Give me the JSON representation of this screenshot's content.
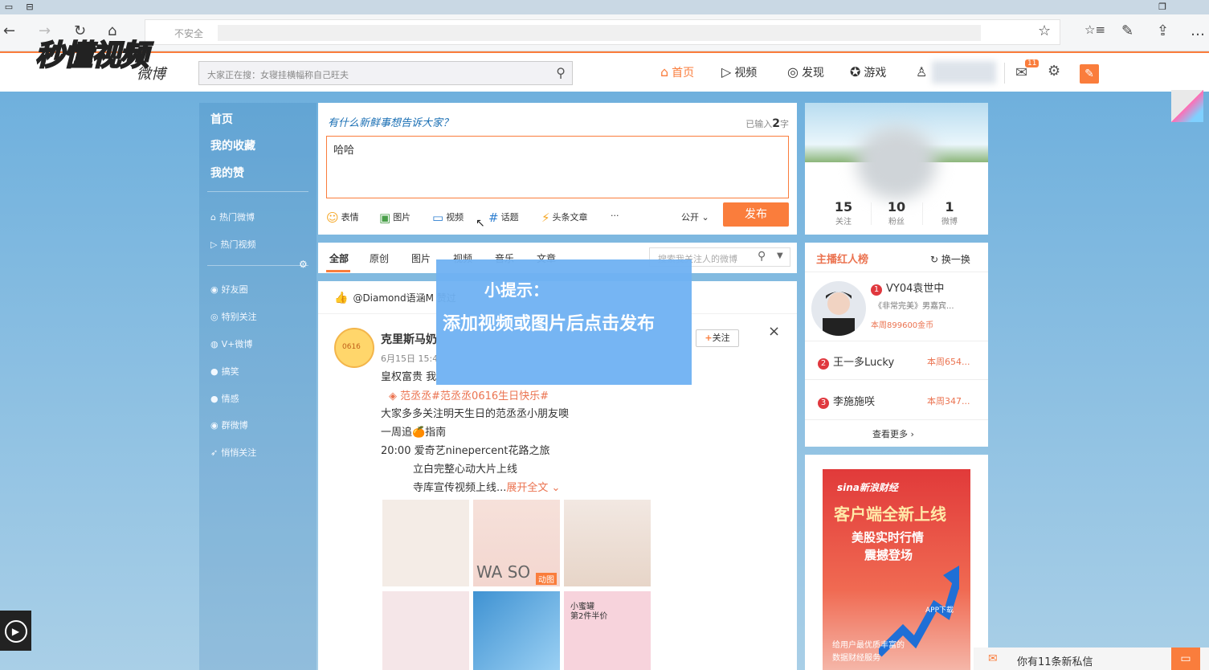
{
  "browser": {
    "url_prefix": "不安全",
    "back": "←",
    "forward": "→",
    "refresh": "↻",
    "home": "⌂",
    "star": "☆",
    "favorites": "☆≡",
    "pen": "✎",
    "share": "⇪",
    "more": "…"
  },
  "watermark": "秒懂视频",
  "logo_word": "微博",
  "header": {
    "search_placeholder": "大家正在搜：女寝挂横幅称自己旺夫",
    "nav": [
      {
        "label": "首页",
        "icon": "⌂"
      },
      {
        "label": "视频",
        "icon": "▷"
      },
      {
        "label": "发现",
        "icon": "◎"
      },
      {
        "label": "游戏",
        "icon": "✪"
      }
    ],
    "user_icon": "♙",
    "msg_icon": "✉",
    "msg_badge": "11",
    "settings_icon": "⚙",
    "compose_icon": "✎",
    "accent": "#fa7d3c"
  },
  "leftnav": {
    "primary": [
      "首页",
      "我的收藏",
      "我的赞"
    ],
    "hot": [
      "热门微博",
      "热门视频"
    ],
    "groups": [
      "好友圈",
      "特别关注",
      "V+微博",
      "搞笑",
      "情感",
      "群微博",
      "悄悄关注"
    ]
  },
  "composer": {
    "title": "有什么新鲜事想告诉大家？",
    "count_prefix": "已输入",
    "count_value": "2",
    "count_suffix": "字",
    "content": "哈哈",
    "tools": [
      "表情",
      "图片",
      "视频",
      "话题",
      "头条文章",
      "···"
    ],
    "visibility": "公开",
    "publish": "发布"
  },
  "feed_tabs": {
    "tabs": [
      "全部",
      "原创",
      "图片",
      "视频",
      "音乐",
      "文章"
    ],
    "search_placeholder": "搜索我关注人的微博"
  },
  "post": {
    "liked_by": "@Diamond语涵M 赞过",
    "avatar_text": "0616",
    "author": "克里斯马奶",
    "time": "6月15日 15:4",
    "line1": "皇权富贵 我",
    "line2_tag1": "范丞丞",
    "line2_tag2": "#范丞丞0616生日快乐#",
    "line3": "大家多多关注明天生日的范丞丞小朋友噢",
    "line4": "一周追🍊指南",
    "line5": "20:00 爱奇艺ninepercent花路之旅",
    "line6": "立白完整心动大片上线",
    "line7": "寺库宣传视频上线...",
    "expand": "展开全文",
    "follow": "关注",
    "follow_plus": "+",
    "close": "×",
    "waso": "WA SO",
    "gif_tag": "动图",
    "promo_line1": "小蜜罐",
    "promo_line2": "第2件半价"
  },
  "tip": {
    "title": "小提示：",
    "body": "添加视频或图片后点击发布"
  },
  "profile": {
    "stats": [
      {
        "n": "15",
        "l": "关注"
      },
      {
        "n": "10",
        "l": "粉丝"
      },
      {
        "n": "1",
        "l": "微博"
      }
    ]
  },
  "rank": {
    "title": "主播红人榜",
    "refresh": "换一换",
    "first": {
      "num": "1",
      "name": "VY04袁世中",
      "desc": "《非常完美》男嘉宾...",
      "coin": "本周899600金币"
    },
    "others": [
      {
        "num": "2",
        "name": "王一多Lucky",
        "week": "本周654..."
      },
      {
        "num": "3",
        "name": "李施施咲",
        "week": "本周347..."
      }
    ],
    "more": "查看更多 ›"
  },
  "ad": {
    "brand": "sina新浪财经",
    "line1": "客户端全新上线",
    "line2": "美股实时行情",
    "line3": "震撼登场",
    "small1": "给用户最优质丰富的",
    "small2": "数据财经服务",
    "app": "APP下载"
  },
  "new_msg": "你有11条新私信",
  "play_icon": "▶"
}
